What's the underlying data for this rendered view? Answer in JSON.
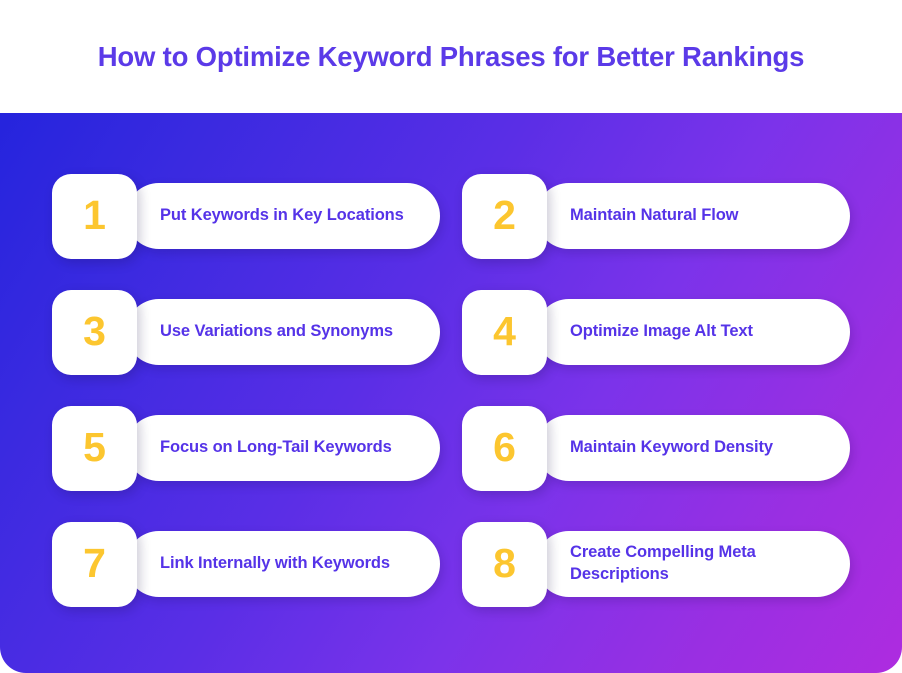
{
  "header": {
    "title": "How to Optimize Keyword Phrases for Better Rankings"
  },
  "theme": {
    "title_color": "#5b3ae8",
    "label_color": "#5533e8",
    "number_color": "#fcc62f",
    "card_background": "#ffffff",
    "gradient_start": "#2524dd",
    "gradient_mid": "#7b33ea",
    "gradient_end": "#ae2ce0",
    "header_background": "#ffffff"
  },
  "items": [
    {
      "number": "1",
      "label": "Put Keywords in Key Locations"
    },
    {
      "number": "2",
      "label": "Maintain Natural Flow"
    },
    {
      "number": "3",
      "label": "Use Variations and Synonyms"
    },
    {
      "number": "4",
      "label": "Optimize Image Alt Text"
    },
    {
      "number": "5",
      "label": "Focus on Long-Tail Keywords"
    },
    {
      "number": "6",
      "label": "Maintain Keyword Density"
    },
    {
      "number": "7",
      "label": "Link Internally with Keywords"
    },
    {
      "number": "8",
      "label": "Create Compelling Meta Descriptions"
    }
  ]
}
